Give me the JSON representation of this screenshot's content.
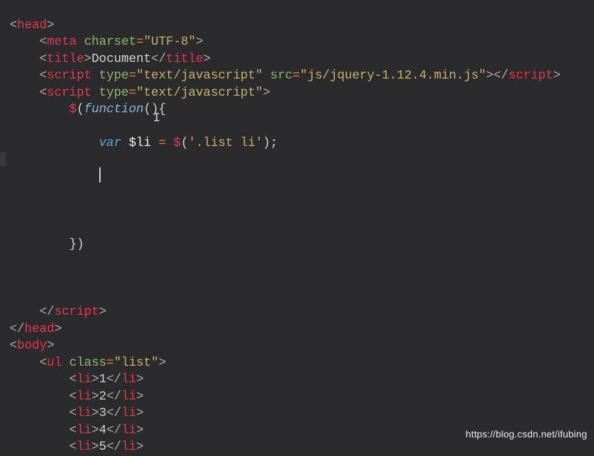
{
  "code": {
    "line1": {
      "t1": "<",
      "tag": "head",
      "t2": ">"
    },
    "line2": {
      "t1": "<",
      "tag": "meta",
      "sp": " ",
      "attr": "charset",
      "eq": "=",
      "val": "\"UTF-8\"",
      "t2": ">"
    },
    "line3": {
      "t1": "<",
      "tag": "title",
      "t2": ">",
      "text": "Document",
      "t3": "</",
      "tag2": "title",
      "t4": ">"
    },
    "line4": {
      "t1": "<",
      "tag": "script",
      "sp": " ",
      "attr1": "type",
      "eq1": "=",
      "val1": "\"text/javascript\"",
      "sp2": " ",
      "attr2": "src",
      "eq2": "=",
      "val2": "\"js/jquery-1.12.4.min.js\"",
      "t2": ">",
      "t3": "</",
      "tag2": "script",
      "t4": ">"
    },
    "line5": {
      "t1": "<",
      "tag": "script",
      "sp": " ",
      "attr": "type",
      "eq": "=",
      "val": "\"text/javascript\"",
      "t2": ">"
    },
    "line6": {
      "d": "$",
      "p1": "(",
      "fn": "function",
      "p2": "(){"
    },
    "line7": {
      "kw": "var",
      "sp": " ",
      "va": "$li",
      "sp2": " ",
      "eq": "=",
      "sp3": " ",
      "d": "$",
      "p1": "(",
      "str": "'.list li'",
      "p2": ");"
    },
    "line8": {
      "close": "})"
    },
    "line9": {
      "t1": "</",
      "tag": "script",
      "t2": ">"
    },
    "line10": {
      "t1": "</",
      "tag": "head",
      "t2": ">"
    },
    "line11": {
      "t1": "<",
      "tag": "body",
      "t2": ">"
    },
    "line12": {
      "t1": "<",
      "tag": "ul",
      "sp": " ",
      "attr": "class",
      "eq": "=",
      "val": "\"list\"",
      "t2": ">"
    },
    "li": [
      {
        "open": "<",
        "tag": "li",
        "c1": ">",
        "text": "1",
        "c2": "</",
        "tag2": "li",
        "c3": ">"
      },
      {
        "open": "<",
        "tag": "li",
        "c1": ">",
        "text": "2",
        "c2": "</",
        "tag2": "li",
        "c3": ">"
      },
      {
        "open": "<",
        "tag": "li",
        "c1": ">",
        "text": "3",
        "c2": "</",
        "tag2": "li",
        "c3": ">"
      },
      {
        "open": "<",
        "tag": "li",
        "c1": ">",
        "text": "4",
        "c2": "</",
        "tag2": "li",
        "c3": ">"
      },
      {
        "open": "<",
        "tag": "li",
        "c1": ">",
        "text": "5",
        "c2": "</",
        "tag2": "li",
        "c3": ">"
      }
    ]
  },
  "watermark": "https://blog.csdn.net/ifubing"
}
